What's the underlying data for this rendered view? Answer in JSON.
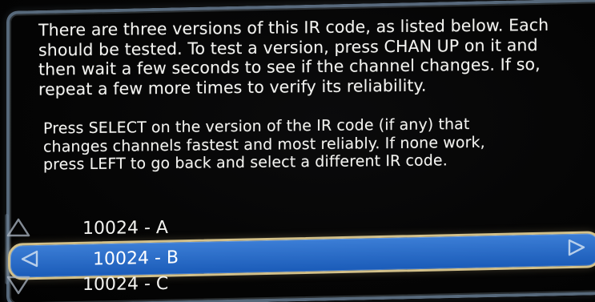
{
  "instructions": {
    "paragraph1": "There are three versions of this IR code, as listed below. Each\nshould be tested. To test a version, press CHAN UP on it and\nthen wait a few seconds to see if the channel changes. If so,\nrepeat a few more times to verify its reliability.",
    "paragraph2": "Press SELECT on the version of the IR code (if any) that\nchanges channels fastest and most reliably. If none work,\npress LEFT to go back and select a different IR code."
  },
  "options": [
    {
      "label": "10024 - A"
    },
    {
      "label": "10024 - B"
    },
    {
      "label": "10024 - C"
    }
  ],
  "colors": {
    "frame": "#5f7286",
    "selection_fill": "#2f73d0",
    "selection_border": "#d2c08a",
    "text": "#f3f3f0"
  },
  "icons": {
    "up": "up-arrow-icon",
    "left": "left-arrow-icon",
    "right": "right-arrow-icon",
    "down": "down-arrow-icon"
  }
}
